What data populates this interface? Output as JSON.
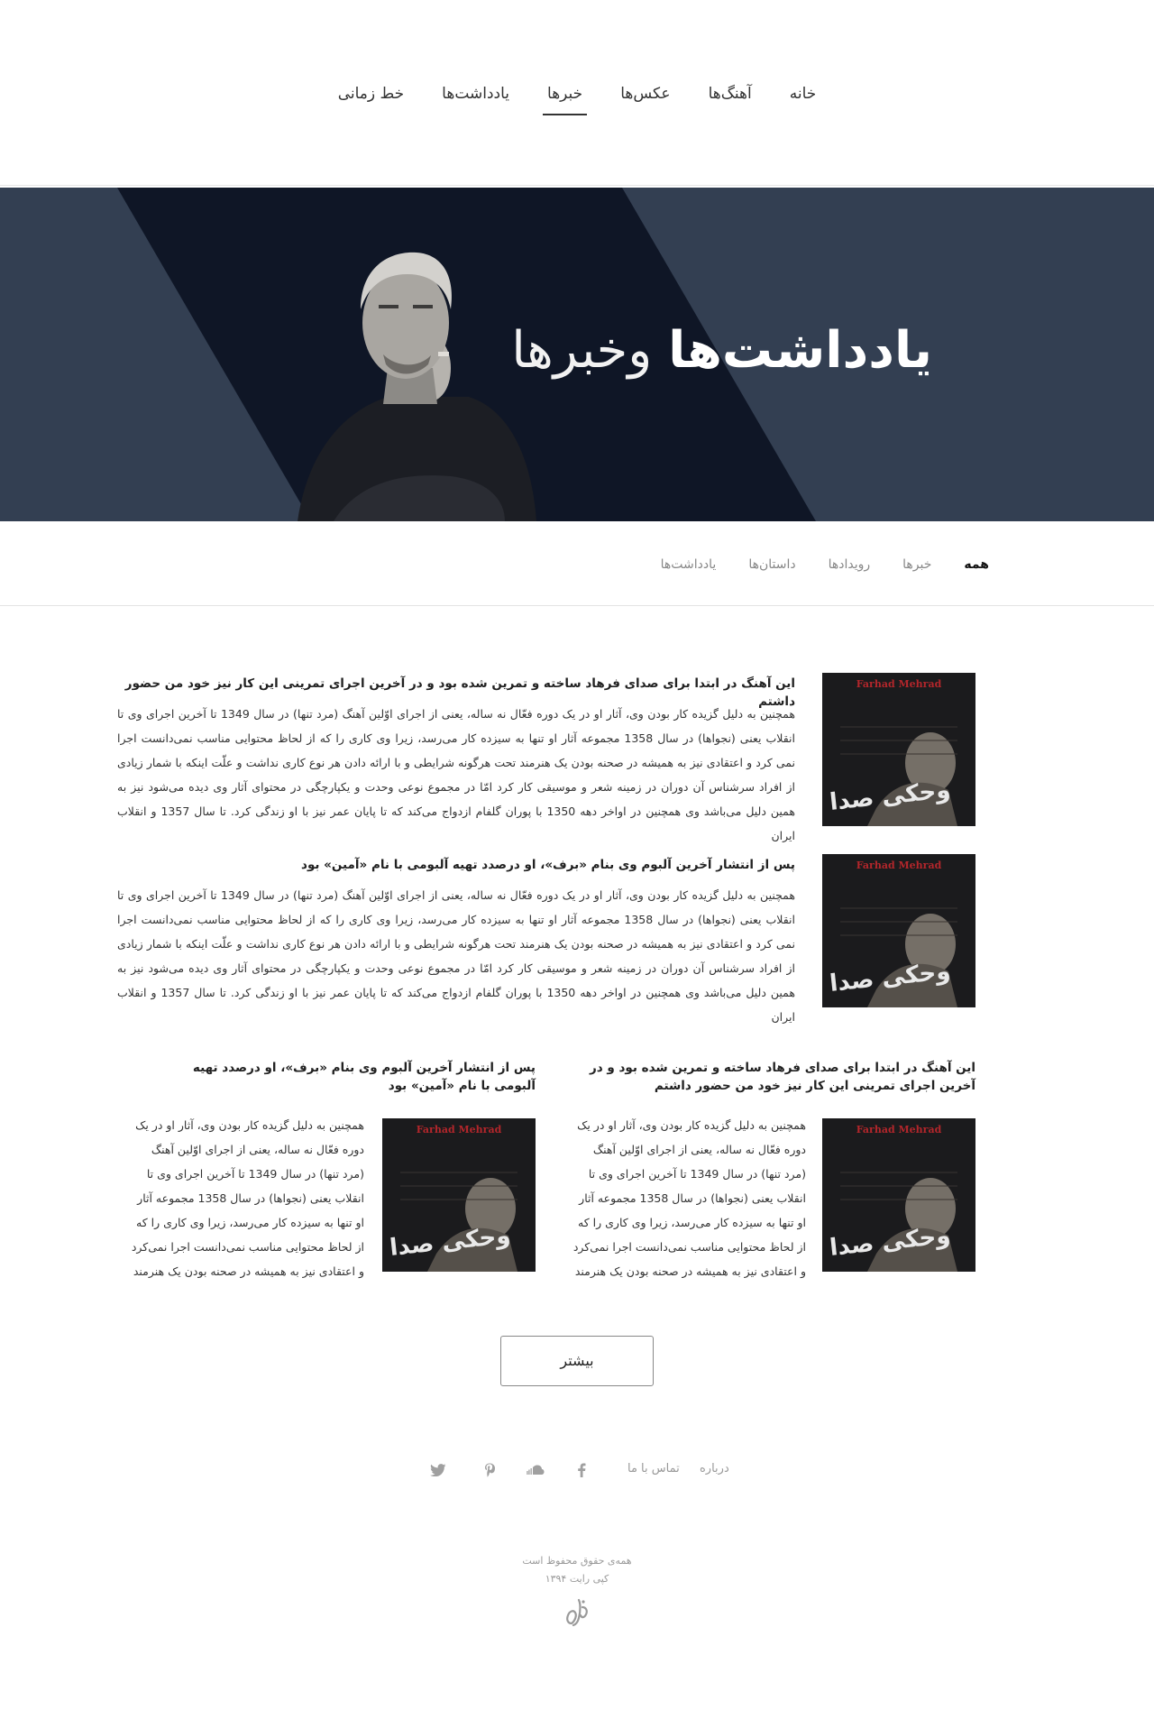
{
  "nav": {
    "items": [
      {
        "label": "خانه",
        "active": false
      },
      {
        "label": "آهنگ‌ها",
        "active": false
      },
      {
        "label": "عکس‌ها",
        "active": false
      },
      {
        "label": "خبرها",
        "active": true
      },
      {
        "label": "یادداشت‌ها",
        "active": false
      },
      {
        "label": "خط زمانی",
        "active": false
      }
    ]
  },
  "hero": {
    "title_bold": "یادداشت‌ها",
    "title_light": " وخبرها",
    "background_color": "#333f52",
    "photo_icon": "portrait-photo"
  },
  "filters": {
    "items": [
      {
        "label": "همه",
        "active": true
      },
      {
        "label": "خبرها",
        "active": false
      },
      {
        "label": "رویدادها",
        "active": false
      },
      {
        "label": "داستان‌ها",
        "active": false
      },
      {
        "label": "یادداشت‌ها",
        "active": false
      }
    ]
  },
  "cover": {
    "album_title": "Farhad Mehrad",
    "script_text": "وحکی صدا"
  },
  "articles": [
    {
      "title": "این آهنگ در ابتدا برای صدای فرهاد ساخته و تمرین شده بود و در آخرین اجرای تمرینی این کار نیز خود من حضور داشتم",
      "body": "همچنین به دلیل گزیده کار بودن وی، آثار او در یک دوره فعّال نه ساله، یعنی از اجرای اوّلین آهنگ (مرد تنها) در سال 1349 تا آخرین اجرای وی تا انقلاب یعنی (نجواها) در سال 1358 مجموعه آثار او تنها به سیزده کار می‌رسد، زیرا وی کاری را که از لحاظ محتوایی مناسب نمی‌دانست اجرا نمی کرد و اعتقادی نیز به همیشه در صحنه بودن یک هنرمند تحت هرگونه شرایطی و با ارائه دادن هر نوع کاری نداشت و علّت اینکه با شمار زیادی از افراد سرشناس آن دوران در زمینه شعر و موسیقی کار کرد امّا در مجموع نوعی وحدت و یکپارچگی در محتوای آثار وی دیده می‌شود نیز به همین دلیل می‌باشد وی همچنین در اواخر دهه 1350 با پوران گلفام ازدواج می‌کند که تا پایان عمر نیز با او زندگی کرد. تا سال 1357 و انقلاب ایران"
    },
    {
      "title": "پس از انتشار آخرین آلبوم وی بنام «برف»، او درصدد تهیه آلبومی با نام «آمین» بود",
      "body": "همچنین به دلیل گزیده کار بودن وی، آثار او در یک دوره فعّال نه ساله، یعنی از اجرای اوّلین آهنگ (مرد تنها) در سال 1349 تا آخرین اجرای وی تا انقلاب یعنی (نجواها) در سال 1358 مجموعه آثار او تنها به سیزده کار می‌رسد، زیرا وی کاری را که از لحاظ محتوایی مناسب نمی‌دانست اجرا نمی کرد و اعتقادی نیز به همیشه در صحنه بودن یک هنرمند تحت هرگونه شرایطی و با ارائه دادن هر نوع کاری نداشت و علّت اینکه با شمار زیادی از افراد سرشناس آن دوران در زمینه شعر و موسیقی کار کرد امّا در مجموع نوعی وحدت و یکپارچگی در محتوای آثار وی دیده می‌شود نیز به همین دلیل می‌باشد وی همچنین در اواخر دهه 1350 با پوران گلفام ازدواج می‌کند که تا پایان عمر نیز با او زندگی کرد. تا سال 1357 و انقلاب ایران"
    },
    {
      "title": "این آهنگ در ابتدا برای صدای فرهاد ساخته و تمرین شده بود و در آخرین اجرای تمرینی این کار نیز خود من حضور داشتم",
      "body": "همچنین به دلیل گزیده کار بودن وی، آثار او در یک دوره فعّال نه ساله، یعنی از اجرای اوّلین آهنگ (مرد تنها) در سال 1349 تا آخرین اجرای وی تا انقلاب یعنی (نجواها) در سال 1358 مجموعه آثار او تنها به سیزده کار می‌رسد، زیرا وی کاری را که از لحاظ محتوایی مناسب نمی‌دانست اجرا نمی‌کرد و اعتقادی نیز به همیشه در صحنه بودن یک هنرمند"
    },
    {
      "title": "پس از انتشار آخرین آلبوم وی بنام «برف»، او درصدد تهیه آلبومی با نام «آمین» بود",
      "body": "همچنین به دلیل گزیده کار بودن وی، آثار او در یک دوره فعّال نه ساله، یعنی از اجرای اوّلین آهنگ (مرد تنها) در سال 1349 تا آخرین اجرای وی تا انقلاب یعنی (نجواها) در سال 1358 مجموعه آثار او تنها به سیزده کار می‌رسد، زیرا وی کاری را که از لحاظ محتوایی مناسب نمی‌دانست اجرا نمی‌کرد و اعتقادی نیز به همیشه در صحنه بودن یک هنرمند"
    }
  ],
  "more_button": {
    "label": "بیشتر"
  },
  "footer": {
    "about": "درباره",
    "contact": "تماس با ما",
    "social_icons": [
      "facebook-icon",
      "soundcloud-icon",
      "pinterest-icon",
      "twitter-icon"
    ],
    "rights": "همه‌ی حقوق محفوظ است",
    "copyright": "کپی رایت ۱۳۹۴",
    "logo": "logo-icon"
  }
}
